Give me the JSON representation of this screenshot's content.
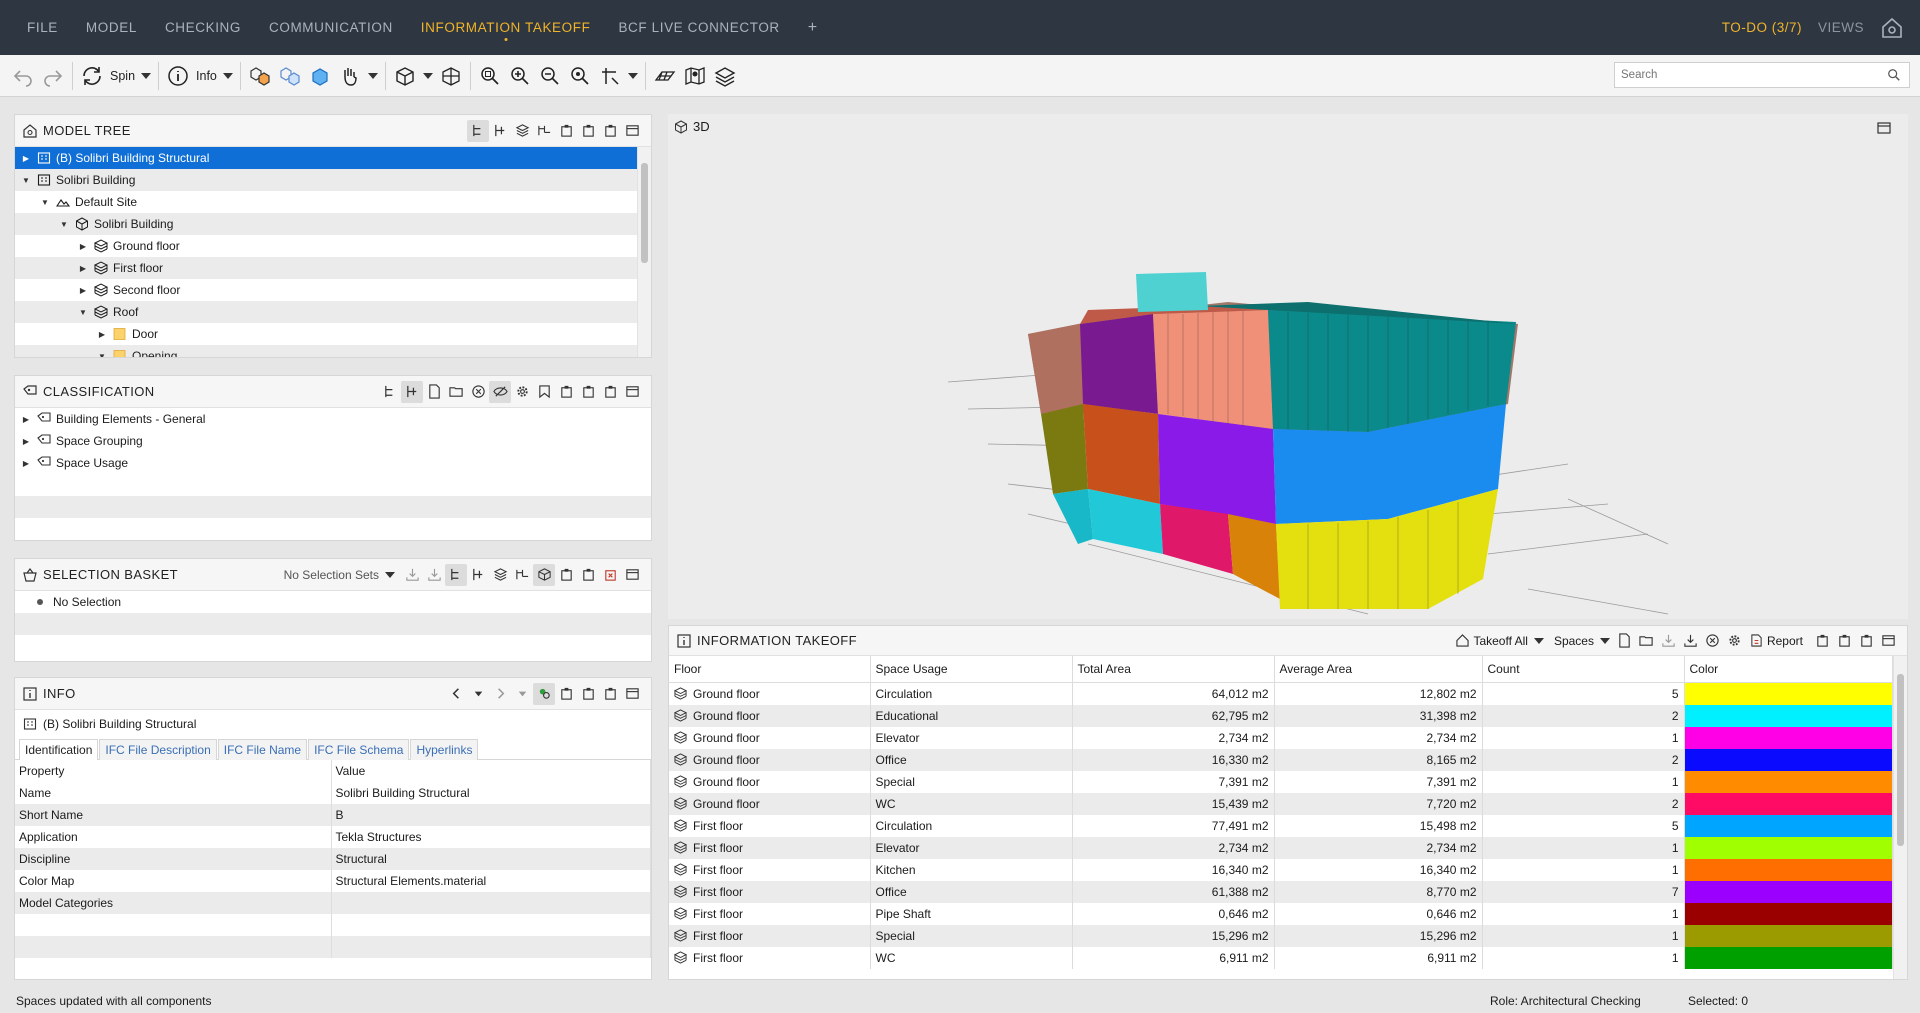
{
  "menu": {
    "items": [
      "FILE",
      "MODEL",
      "CHECKING",
      "COMMUNICATION",
      "INFORMATION TAKEOFF",
      "BCF LIVE CONNECTOR"
    ],
    "active_index": 4,
    "plus": "+",
    "todo": "TO-DO (3/7)",
    "views": "VIEWS"
  },
  "toolbar": {
    "spin_label": "Spin",
    "info_label": "Info",
    "search_placeholder": "Search"
  },
  "model_tree": {
    "title": "MODEL TREE",
    "rows": [
      {
        "label": "(B) Solibri Building Structural",
        "indent": 0,
        "expanded": false,
        "selected": true,
        "icon": "building-icon"
      },
      {
        "label": "Solibri Building",
        "indent": 0,
        "expanded": true,
        "icon": "building-icon"
      },
      {
        "label": "Default Site",
        "indent": 1,
        "expanded": true,
        "icon": "site-icon"
      },
      {
        "label": "Solibri Building",
        "indent": 2,
        "expanded": true,
        "icon": "cube-icon"
      },
      {
        "label": "Ground floor",
        "indent": 3,
        "expanded": false,
        "icon": "floor-icon"
      },
      {
        "label": "First floor",
        "indent": 3,
        "expanded": false,
        "icon": "floor-icon"
      },
      {
        "label": "Second floor",
        "indent": 3,
        "expanded": false,
        "icon": "floor-icon"
      },
      {
        "label": "Roof",
        "indent": 3,
        "expanded": true,
        "icon": "floor-icon"
      },
      {
        "label": "Door",
        "indent": 4,
        "expanded": false,
        "icon": "folder-icon"
      },
      {
        "label": "Opening",
        "indent": 4,
        "expanded": true,
        "icon": "folder-icon"
      }
    ]
  },
  "classification": {
    "title": "CLASSIFICATION",
    "rows": [
      "Building Elements - General",
      "Space Grouping",
      "Space Usage"
    ]
  },
  "selection_basket": {
    "title": "SELECTION BASKET",
    "sets_label": "No Selection Sets",
    "empty": "No Selection"
  },
  "info": {
    "title": "INFO",
    "object": "(B) Solibri Building Structural",
    "tabs": [
      "Identification",
      "IFC File Description",
      "IFC File Name",
      "IFC File Schema",
      "Hyperlinks"
    ],
    "active_tab": 0,
    "col_property": "Property",
    "col_value": "Value",
    "rows": [
      {
        "property": "Name",
        "value": "Solibri Building Structural"
      },
      {
        "property": "Short Name",
        "value": "B"
      },
      {
        "property": "Application",
        "value": "Tekla Structures"
      },
      {
        "property": "Discipline",
        "value": "Structural"
      },
      {
        "property": "Color Map",
        "value": "Structural Elements.material"
      },
      {
        "property": "Model Categories",
        "value": ""
      }
    ]
  },
  "view3d": {
    "title": "3D"
  },
  "takeoff": {
    "title": "INFORMATION TAKEOFF",
    "takeoff_all": "Takeoff All",
    "spaces": "Spaces",
    "report": "Report",
    "columns": [
      "Floor",
      "Space Usage",
      "Total Area",
      "Average Area",
      "Count",
      "Color"
    ],
    "rows": [
      {
        "floor": "Ground floor",
        "usage": "Circulation",
        "total": "64,012 m2",
        "avg": "12,802 m2",
        "count": "5",
        "color": "#ffff00"
      },
      {
        "floor": "Ground floor",
        "usage": "Educational",
        "total": "62,795 m2",
        "avg": "31,398 m2",
        "count": "2",
        "color": "#00f0ff"
      },
      {
        "floor": "Ground floor",
        "usage": "Elevator",
        "total": "2,734 m2",
        "avg": "2,734 m2",
        "count": "1",
        "color": "#ff00e6"
      },
      {
        "floor": "Ground floor",
        "usage": "Office",
        "total": "16,330 m2",
        "avg": "8,165 m2",
        "count": "2",
        "color": "#0a0aff"
      },
      {
        "floor": "Ground floor",
        "usage": "Special",
        "total": "7,391 m2",
        "avg": "7,391 m2",
        "count": "1",
        "color": "#ff8c00"
      },
      {
        "floor": "Ground floor",
        "usage": "WC",
        "total": "15,439 m2",
        "avg": "7,720 m2",
        "count": "2",
        "color": "#ff0a64"
      },
      {
        "floor": "First floor",
        "usage": "Circulation",
        "total": "77,491 m2",
        "avg": "15,498 m2",
        "count": "5",
        "color": "#00a5ff"
      },
      {
        "floor": "First floor",
        "usage": "Elevator",
        "total": "2,734 m2",
        "avg": "2,734 m2",
        "count": "1",
        "color": "#a0ff00"
      },
      {
        "floor": "First floor",
        "usage": "Kitchen",
        "total": "16,340 m2",
        "avg": "16,340 m2",
        "count": "1",
        "color": "#ff6e00"
      },
      {
        "floor": "First floor",
        "usage": "Office",
        "total": "61,388 m2",
        "avg": "8,770 m2",
        "count": "7",
        "color": "#9b00ff"
      },
      {
        "floor": "First floor",
        "usage": "Pipe Shaft",
        "total": "0,646 m2",
        "avg": "0,646 m2",
        "count": "1",
        "color": "#9b0000"
      },
      {
        "floor": "First floor",
        "usage": "Special",
        "total": "15,296 m2",
        "avg": "15,296 m2",
        "count": "1",
        "color": "#9b9b00"
      },
      {
        "floor": "First floor",
        "usage": "WC",
        "total": "6,911 m2",
        "avg": "6,911 m2",
        "count": "1",
        "color": "#00a000"
      }
    ]
  },
  "status": {
    "message": "Spaces updated with all components",
    "role": "Role: Architectural Checking",
    "selected": "Selected: 0"
  }
}
